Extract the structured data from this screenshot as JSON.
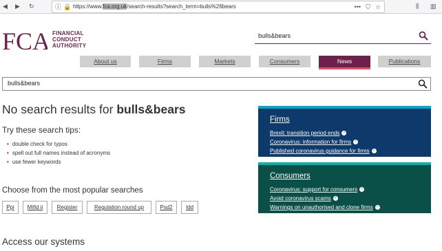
{
  "browser": {
    "url_prefix": "https://www.",
    "url_domain": "fca.org.uk",
    "url_path": "/search-results?search_term=bulls%26bears",
    "menu_dots": "•••"
  },
  "header": {
    "logo_letters": "FCA",
    "logo_line1": "FINANCIAL",
    "logo_line2": "CONDUCT",
    "logo_line3": "AUTHORITY",
    "search_value": "bulls&bears"
  },
  "nav": [
    {
      "label": "About us"
    },
    {
      "label": "Firms"
    },
    {
      "label": "Markets"
    },
    {
      "label": "Consumers"
    },
    {
      "label": "News"
    },
    {
      "label": "Publications"
    }
  ],
  "search": {
    "value": "bulls&bears"
  },
  "results": {
    "heading_prefix": "No search results for ",
    "heading_term": "bulls&bears",
    "tips_heading": "Try these search tips:",
    "tips": [
      "double check for typos",
      "spell out full names instead of acronyms",
      "use fewer keywords"
    ],
    "popular_heading": "Choose from the most popular searches",
    "popular": [
      "Ppi",
      "Mifid ii",
      "Register",
      "Regulation round up",
      "Psd2",
      "Idd"
    ],
    "access_heading": "Access our systems"
  },
  "panels": {
    "firms": {
      "title": "Firms",
      "links": [
        "Brexit: transition period ends",
        "Coronavirus: information for firms",
        "Published coronavirus guidance for firms"
      ]
    },
    "consumers": {
      "title": "Consumers",
      "links": [
        "Coronavirus: support for consumers",
        "Avoid coronavirus scams",
        "Warnings on unauthorised and clone firms"
      ]
    }
  },
  "colors": {
    "brand": "#6e1f4b",
    "firms_panel": "#0d3a6b",
    "consumers_panel": "#0a4f48",
    "active_underline": "#e2516d"
  }
}
